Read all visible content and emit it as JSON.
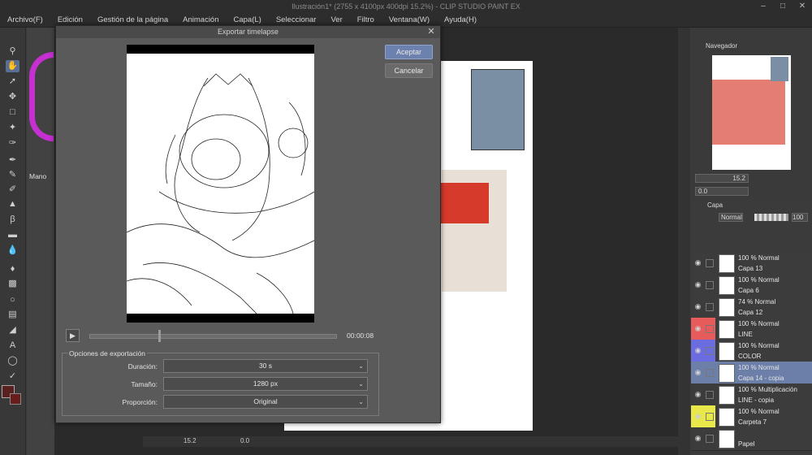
{
  "window": {
    "title": "Ilustración1* (2755 x 4100px 400dpi 15.2%) - CLIP STUDIO PAINT EX"
  },
  "menu": [
    "Archivo(F)",
    "Edición",
    "Gestión de la página",
    "Animación",
    "Capa(L)",
    "Seleccionar",
    "Ver",
    "Filtro",
    "Ventana(W)",
    "Ayuda(H)"
  ],
  "subtool": {
    "label": "Mano"
  },
  "navigator": {
    "title": "Navegador",
    "zoom": "15.2",
    "angle": "0.0"
  },
  "layer_panel": {
    "tab": "Capa",
    "blend_mode": "Normal",
    "opacity": "100",
    "layers": [
      {
        "mode": "100 % Normal",
        "name": "Capa 13",
        "color": null,
        "selected": false
      },
      {
        "mode": "100 % Normal",
        "name": "Capa 6",
        "color": null,
        "selected": false
      },
      {
        "mode": "74 % Normal",
        "name": "Capa 12",
        "color": null,
        "selected": false
      },
      {
        "mode": "100 % Normal",
        "name": "LINE",
        "color": "#e85b5b",
        "selected": false
      },
      {
        "mode": "100 % Normal",
        "name": "COLOR",
        "color": "#6a6ce0",
        "selected": false
      },
      {
        "mode": "100 % Normal",
        "name": "Capa 14 - copia",
        "color": null,
        "selected": true
      },
      {
        "mode": "100 % Multiplicación",
        "name": "LINE - copia",
        "color": null,
        "selected": false
      },
      {
        "mode": "100 % Normal",
        "name": "Carpeta 7",
        "color": "#e8e84a",
        "selected": false
      },
      {
        "mode": "",
        "name": "Papel",
        "color": null,
        "selected": false
      }
    ]
  },
  "dialog": {
    "title": "Exportar timelapse",
    "ok_label": "Aceptar",
    "cancel_label": "Cancelar",
    "time": "00:00:08",
    "playback_position": 0.28,
    "options_title": "Opciones de exportación",
    "options": [
      {
        "label": "Duración:",
        "value": "30 s"
      },
      {
        "label": "Tamaño:",
        "value": "1280 px"
      },
      {
        "label": "Proporción:",
        "value": "Original"
      }
    ]
  },
  "statusbar": {
    "zoom": "15.2",
    "angle": "0.0"
  },
  "colors": {
    "accent": "#6c81ad",
    "selection": "#6b7fa8",
    "main_color": "#5a2020"
  }
}
